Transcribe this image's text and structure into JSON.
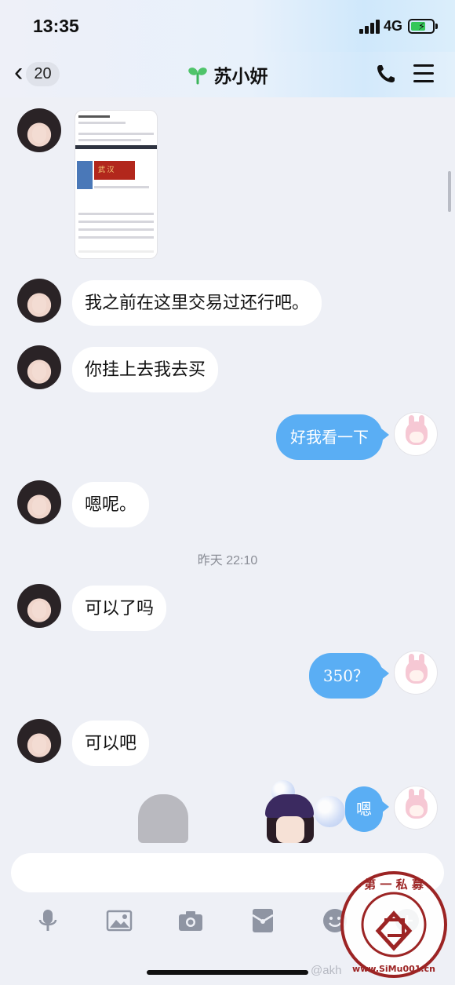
{
  "status_bar": {
    "time": "13:35",
    "network": "4G",
    "battery_charging": true
  },
  "nav": {
    "back_count": "20",
    "title": "苏小妍"
  },
  "messages": [
    {
      "from": "her",
      "type": "image"
    },
    {
      "from": "her",
      "text": "我之前在这里交易过还行吧。"
    },
    {
      "from": "her",
      "text": "你挂上去我去买"
    },
    {
      "from": "me",
      "text": "好我看一下"
    },
    {
      "from": "her",
      "text": "嗯呢。"
    },
    {
      "from": "system",
      "text": "昨天 22:10"
    },
    {
      "from": "her",
      "text": "可以了吗"
    },
    {
      "from": "me",
      "text": "350？"
    },
    {
      "from": "her",
      "text": "可以吧"
    },
    {
      "from": "me",
      "text": "嗯",
      "type": "sticker-and-text"
    }
  ],
  "thumbnail": {
    "banner_text": "武 汉"
  },
  "toolbar": {
    "icons": [
      "microphone-icon",
      "image-icon",
      "camera-icon",
      "red-packet-icon",
      "emoji-icon",
      "more-icon"
    ]
  },
  "watermark": {
    "top": "第 一 私 募",
    "bottom": "www.SiMu001.cn",
    "credit": "@akh"
  },
  "colors": {
    "accent": "#5aaef4",
    "background": "#eef0f6",
    "bubble_her": "#ffffff"
  }
}
